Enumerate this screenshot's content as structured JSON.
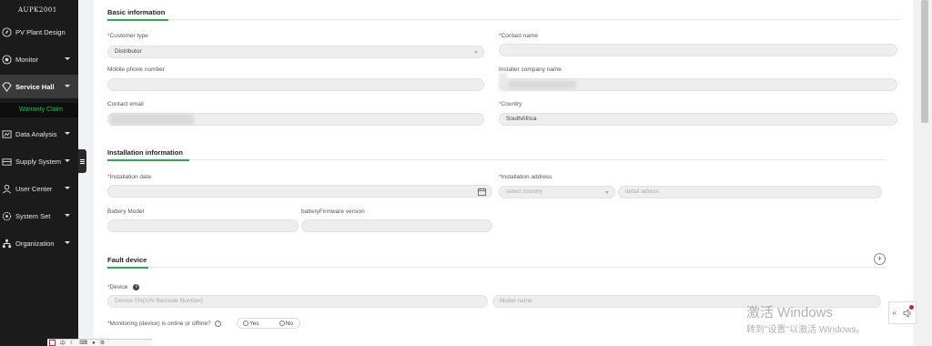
{
  "sidebar": {
    "brand": "AUPK2001",
    "items": [
      {
        "label": "PV Plant Design",
        "icon": "leaf-icon",
        "caret": false
      },
      {
        "label": "Monitor",
        "icon": "monitor-icon",
        "caret": true
      },
      {
        "label": "Service Hall",
        "icon": "diamond-icon",
        "caret": true,
        "active": true
      },
      {
        "label": "Data Analysis",
        "icon": "analysis-icon",
        "caret": true
      },
      {
        "label": "Supply System",
        "icon": "supply-icon",
        "caret": true
      },
      {
        "label": "User Center",
        "icon": "user-icon",
        "caret": true
      },
      {
        "label": "System Set",
        "icon": "gear-icon",
        "caret": true
      },
      {
        "label": "Organization",
        "icon": "org-icon",
        "caret": true
      }
    ],
    "sub_item": "Warranty Claim",
    "active_color": "#1fc24a"
  },
  "basic": {
    "title": "Basic information",
    "customer_type_label": "Customer type",
    "customer_type_value": "Distributor",
    "contact_name_label": "Contact name",
    "mobile_label": "Mobile phone number",
    "installer_label": "Installer company name",
    "email_label": "Contact email",
    "country_label": "Country",
    "country_value": "SouthAfrica"
  },
  "install": {
    "title": "Installation information",
    "date_label": "Installation date",
    "address_label": "Installation address",
    "select_country_placeholder": "select country",
    "detail_address_placeholder": "detail adress",
    "battery_model_label": "Battery Model",
    "battery_fw_label": "batteryFirmware version"
  },
  "fault": {
    "title": "Fault device",
    "add_symbol": "+",
    "device_label": "Device",
    "device_sn_placeholder": "Device SN(S/N Barcode Number)",
    "model_name_placeholder": "Model name",
    "monitoring_label": "Monitoring (device) is online or offline?",
    "yes_label": "Yes",
    "no_label": "No"
  },
  "required_mark": "*",
  "watermark": {
    "line1": "激活 Windows",
    "line2": "转到\"设置\"以激活 Windows。"
  },
  "ime": {
    "lang": "中"
  },
  "colors": {
    "accent": "#22b24c",
    "required": "#e0402a",
    "sidebar_bg": "#1b1b1b"
  }
}
